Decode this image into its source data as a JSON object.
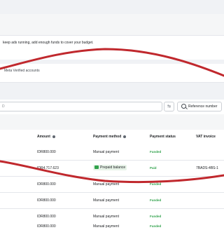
{
  "notice": {
    "text": "keep ads running, add enough funds to cover your budget."
  },
  "verified": {
    "label": "Meta Verified accounts"
  },
  "filters": {
    "search_text": "D",
    "reference_label": "Reference number"
  },
  "table": {
    "headers": {
      "amount": "Amount",
      "payment_method": "Payment method",
      "payment_status": "Payment status",
      "vat_invoice": "VAT invoice"
    },
    "rows": [
      {
        "amount": "IDR800.000",
        "method": "Manual payment",
        "status": "Funded",
        "vat": ""
      },
      {
        "amount": "IDR4.717.623",
        "method": "Prepaid balance",
        "status": "Paid",
        "vat": "7BADS-4BS-1"
      },
      {
        "amount": "IDR800.000",
        "method": "Manual payment",
        "status": "Funded",
        "vat": ""
      },
      {
        "amount": "IDR800.000",
        "method": "Manual payment",
        "status": "Funded",
        "vat": ""
      },
      {
        "amount": "IDR800.000",
        "method": "Manual payment",
        "status": "Funded",
        "vat": ""
      },
      {
        "amount": "IDR800.000",
        "method": "Manual payment",
        "status": "Funded",
        "vat": ""
      }
    ]
  },
  "icons": {
    "swap": "swap-arrows-icon",
    "search": "search-icon",
    "info": "info-icon",
    "prepaid": "wallet-icon"
  },
  "colors": {
    "annotation": "#c0282d",
    "status_green": "#31a24c"
  }
}
